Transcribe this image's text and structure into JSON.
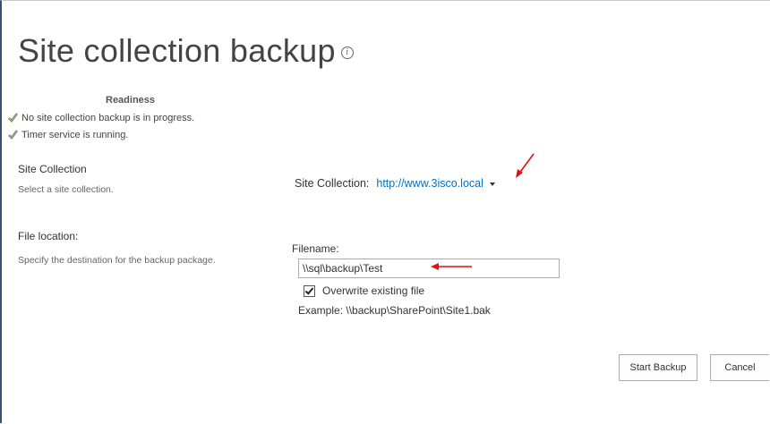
{
  "page": {
    "title": "Site collection backup",
    "info_icon": "info-icon"
  },
  "readiness": {
    "heading": "Readiness",
    "items": [
      {
        "icon": "check-icon",
        "text": "No site collection backup is in progress."
      },
      {
        "icon": "check-icon",
        "text": "Timer service is running."
      }
    ]
  },
  "site_collection": {
    "section_label": "Site Collection",
    "section_desc": "Select a site collection.",
    "field_label": "Site Collection:",
    "selected_url": "http://www.3isco.local",
    "dropdown_icon": "chevron-down-icon"
  },
  "file_location": {
    "section_label": "File location:",
    "section_desc": "Specify the destination for the backup package.",
    "filename_label": "Filename:",
    "filename_value": "\\\\sql\\backup\\Test",
    "overwrite_label": "Overwrite existing file",
    "overwrite_checked": true,
    "example": "Example: \\\\backup\\SharePoint\\Site1.bak"
  },
  "buttons": {
    "start": "Start Backup",
    "cancel": "Cancel"
  },
  "colors": {
    "link": "#0072c6",
    "annotation_arrow": "#e01010",
    "frame_border": "#3a4f73"
  }
}
